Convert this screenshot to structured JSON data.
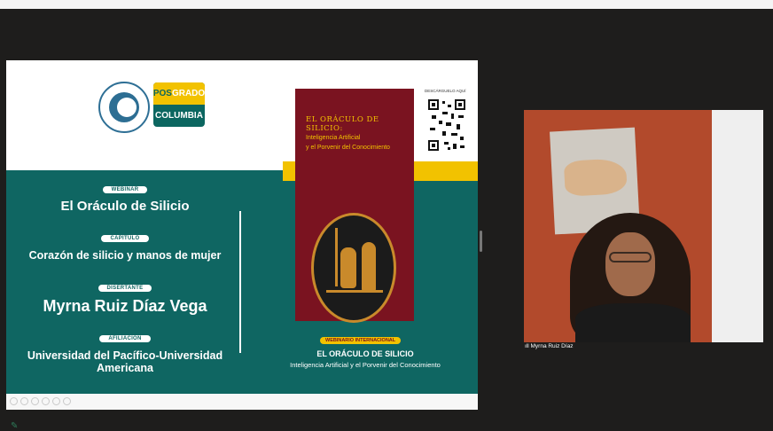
{
  "slide": {
    "webinar_pill": "WEBINAR",
    "webinar_title": "El Oráculo de Silicio",
    "chapter_pill": "CAPÍTULO",
    "chapter_title": "Corazón de silicio y manos de mujer",
    "speaker_pill": "DISERTANTE",
    "speaker_name": "Myrna Ruiz Díaz Vega",
    "affiliation_pill": "AFILIACIÓN",
    "affiliation": "Universidad del Pacífico-Universidad Americana",
    "posgrado_top_a": "POS",
    "posgrado_top_b": "GRADO",
    "posgrado_bottom": "COLUMBIA",
    "qr_label": "DESCÁRGUELO AQUÍ",
    "book_title": "EL ORÁCULO DE SILICIO:",
    "book_sub1": "Inteligencia Artificial",
    "book_sub2": "y el Porvenir del Conocimiento",
    "intl_pill": "WEBINARIO INTERNACIONAL",
    "intl_title": "EL ORÁCULO DE SILICIO",
    "intl_sub": "Inteligencia Artificial y el Porvenir del Conocimiento"
  },
  "participant": {
    "name": "Myrna Ruiz Díaz"
  },
  "icons": {
    "mic": "microphone-icon",
    "signal": "signal-bars-icon"
  },
  "colors": {
    "teal": "#0f6662",
    "yellow": "#f2c200",
    "maroon": "#7a1320"
  }
}
